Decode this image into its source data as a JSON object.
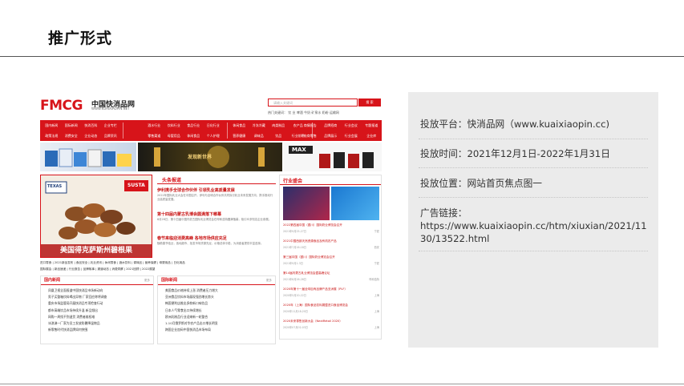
{
  "slide": {
    "title": "推广形式"
  },
  "screenshot": {
    "site_logo": "FMCG",
    "site_name": "中国快消品网",
    "site_url": "WWW.KUAIXIAOPIN.NET",
    "search_placeholder": "请输入关键词",
    "search_button": "搜 索",
    "hotwords": "热门关键词：  饮 业    啤酒   牛奶   矿泉水   奶粉   运输网",
    "nav_group_1": [
      "国内新闻",
      "国际新闻",
      "快消百科",
      "企业专栏",
      "政策法规",
      "消费安全",
      "企业动态",
      "品牌资讯"
    ],
    "nav_group_2": [
      "酒水行业",
      "饮料行业",
      "食品行业",
      "日化行业",
      "零售渠道",
      "母婴用品",
      "休闲食品",
      "个人护理"
    ],
    "nav_group_3": [
      "休闲食品",
      "冷冻冷藏",
      "肉类制品",
      "农产品",
      "营养健康",
      "调味品",
      "饮品",
      "行业前瞻"
    ],
    "nav_group_4": [
      "商情报告",
      "品牌招商",
      "行业会议",
      "专题报道",
      "电商零售",
      "品牌展示",
      "行业会展",
      "企业库"
    ],
    "ad_banner_text": "发现新世界",
    "ad_max_text": "MAX",
    "focus_caption": "美国得克萨斯州碧根果",
    "focus_brand_left": "TEXAS",
    "focus_brand_right": "SUSTA",
    "headline_section": "头条报道",
    "headlines": [
      {
        "title": "伊利携手全球合作伙伴 引领乳业高质量发展",
        "desc": "2022年国际乳业大会在中国召开，伊利与全球合作伙伴共同探讨乳业未来发展方向，携手推动行业高质量发展。"
      },
      {
        "title": "第十四届内蒙古乳博会圆满落下帷幕",
        "desc": "8月28日，第十四届中国内蒙古国际乳业博览会在呼和浩特圆满落幕，吸引众多知名企业参展。"
      },
      {
        "title": "春节来临迎消费高峰 各地市场供应充足",
        "desc": "随着春节临近，各地超市、批发市场货源充足，价格总体平稳，为消费者提供丰富选择。"
      }
    ],
    "link_row_1": "进口零食 | 2021新品发布 | 食品安全 | 乳业资讯 | 休闲零食 | 酒水饮料 | 调味品 | 营养保健 | 母婴用品 | 日化用品",
    "link_row_2": "国际展会 | 新品速递 | 行业报告 | 品牌故事 | 渠道动态 | 消费洞察 | 2021回顾 | 2022展望",
    "industry_section": "行业盛会",
    "industry_items": [
      {
        "title": "2022第四届中国（银川）国际奶业博览会召开",
        "date": "2021年9月25-27日",
        "place": "宁夏"
      },
      {
        "title": "2021中国西部天然资源食品及有机农产品",
        "date": "2021年7月16-18日",
        "place": "西安"
      },
      {
        "title": "第三届中国（银川）国际奶业博览会召开",
        "date": "2021年9月1-3日",
        "place": "宁夏"
      },
      {
        "title": "第14届内蒙古乳业博览会暨高峰论坛",
        "date": "2021年8月26-28日",
        "place": "呼和浩特"
      },
      {
        "title": "2020年第十一届全球自有品牌产品亚洲展（PLF）",
        "date": "2020年5月20-22日",
        "place": "上海"
      },
      {
        "title": "2020年（上海）国际食品饮料展暨进口食品博览会",
        "date": "2020年11月18-20日",
        "place": "上海"
      },
      {
        "title": "2020未来零售创新大会（NextRetail 2020）",
        "date": "2020年07月02-03日",
        "place": "上海"
      }
    ],
    "domestic_section": "国内新闻",
    "domestic_news": [
      "凤凰卫视全面报道中国快消品市场新动向",
      "男子买整箱饮料喝出异物 厂家回应称将调查",
      "重庆市场监管局开展快消品专项检查行动",
      "都市高端饮品市场持续升温 新品频出",
      "网购一周找不到退货 消费者维权难",
      "冰淇淋一厂家为员工发放防暑降温物品",
      "新零售时代快消品牌如何突围"
    ],
    "intl_section": "国际新闻",
    "intl_news": [
      "美国食品价格持续上涨 消费者压力增大",
      "亚洲食品饮料市场展现强劲增长势头",
      "韩国便利店推出多款新口味饮品",
      "日本人气零食出口持续增长",
      "欧洲乳制品行业迎来新一轮整合",
      "1-10月俄罗斯对华农产品出口增长明显",
      "跨国企业加码中国快消品市场布局"
    ],
    "more_label": "更多"
  },
  "info": {
    "platform": "投放平台：快消品网（www.kuaixiaopin.cc)",
    "period": "投放时间：2021年12月1日-2022年1月31日",
    "position": "投放位置：网站首页焦点图一",
    "link_label": "广告链接：",
    "link_url": "https://www.kuaixiaopin.cc/htm/xiuxian/2021/1130/13522.html"
  },
  "colors": {
    "brand_red": "#d7141a",
    "panel_gray": "#ebebeb"
  }
}
